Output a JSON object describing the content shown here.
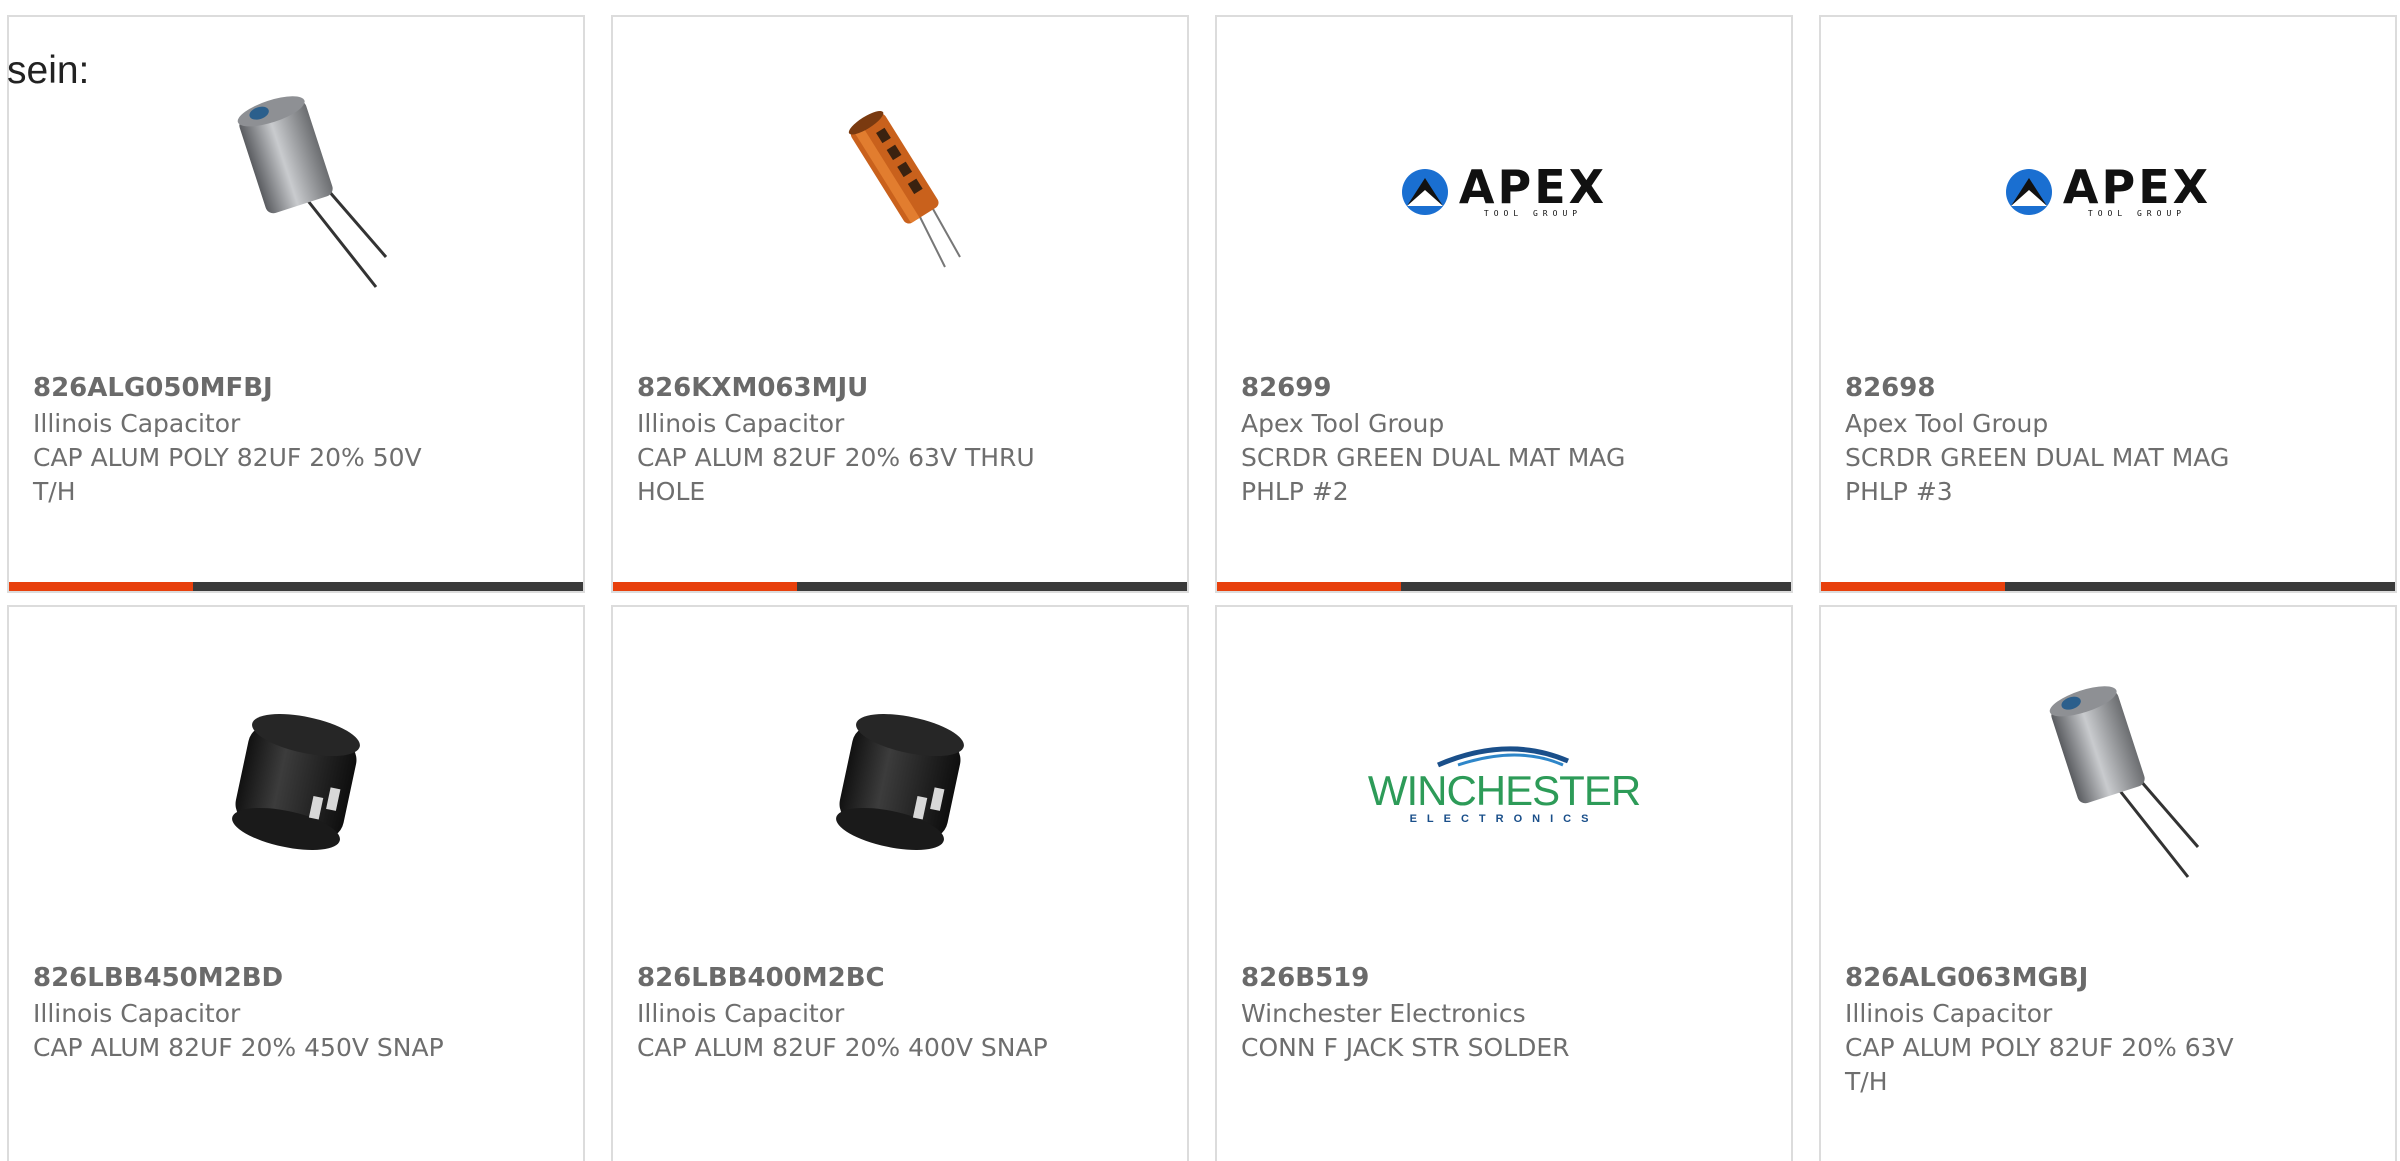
{
  "intro_text": "sein:",
  "accent_color": "#e8400c",
  "products": [
    {
      "part_number": "826ALG050MFBJ",
      "manufacturer": "Illinois Capacitor",
      "description": "CAP ALUM POLY 82UF 20% 50V T/H",
      "image": "silver-radial-capacitor"
    },
    {
      "part_number": "826KXM063MJU",
      "manufacturer": "Illinois Capacitor",
      "description": "CAP ALUM 82UF 20% 63V THRU HOLE",
      "image": "orange-axial-capacitor"
    },
    {
      "part_number": "82699",
      "manufacturer": "Apex Tool Group",
      "description": "SCRDR GREEN DUAL MAT MAG PHLP #2",
      "image": "apex-tool-group-logo",
      "logo_text": "APEX",
      "logo_subtext": "TOOL GROUP"
    },
    {
      "part_number": "82698",
      "manufacturer": "Apex Tool Group",
      "description": "SCRDR GREEN DUAL MAT MAG PHLP #3",
      "image": "apex-tool-group-logo",
      "logo_text": "APEX",
      "logo_subtext": "TOOL GROUP"
    },
    {
      "part_number": "826LBB450M2BD",
      "manufacturer": "Illinois Capacitor",
      "description": "CAP ALUM 82UF 20% 450V SNAP",
      "image": "black-snap-in-capacitor"
    },
    {
      "part_number": "826LBB400M2BC",
      "manufacturer": "Illinois Capacitor",
      "description": "CAP ALUM 82UF 20% 400V SNAP",
      "image": "black-snap-in-capacitor"
    },
    {
      "part_number": "826B519",
      "manufacturer": "Winchester Electronics",
      "description": "CONN F JACK STR SOLDER",
      "image": "winchester-electronics-logo",
      "logo_text": "WINCHESTER",
      "logo_subtext": "ELECTRONICS"
    },
    {
      "part_number": "826ALG063MGBJ",
      "manufacturer": "Illinois Capacitor",
      "description": "CAP ALUM POLY 82UF 20% 63V T/H",
      "image": "silver-radial-capacitor"
    }
  ]
}
